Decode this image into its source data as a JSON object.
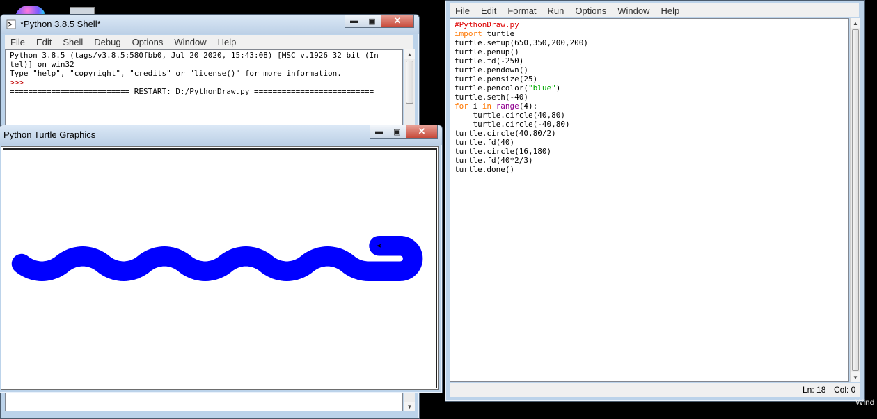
{
  "shell": {
    "title": "*Python 3.8.5 Shell*",
    "menu": [
      "File",
      "Edit",
      "Shell",
      "Debug",
      "Options",
      "Window",
      "Help"
    ],
    "lines": [
      "Python 3.8.5 (tags/v3.8.5:580fbb0, Jul 20 2020, 15:43:08) [MSC v.1926 32 bit (In",
      "tel)] on win32",
      "Type \"help\", \"copyright\", \"credits\" or \"license()\" for more information."
    ],
    "prompt": ">>>",
    "restart_line": "========================== RESTART: D:/PythonDraw.py =========================="
  },
  "turtle": {
    "title": "Python Turtle Graphics",
    "pen_color": "#0000ff",
    "pen_size": 25,
    "canvas_background": "#ffffff"
  },
  "editor": {
    "menu": [
      "File",
      "Edit",
      "Format",
      "Run",
      "Options",
      "Window",
      "Help"
    ],
    "code": [
      {
        "c": "#PythonDraw.py",
        "t": "cm"
      },
      {
        "k": "import",
        "r": " turtle"
      },
      "turtle.setup(650,350,200,200)",
      "turtle.penup()",
      "turtle.fd(-250)",
      "turtle.pendown()",
      "turtle.pensize(25)",
      {
        "pre": "turtle.pencolor(",
        "s": "\"blue\"",
        "post": ")"
      },
      "turtle.seth(-40)",
      {
        "for": true,
        "k": "for",
        "m": " i ",
        "k2": "in",
        "sp": " ",
        "b": "range",
        "r": "(4):"
      },
      "    turtle.circle(40,80)",
      "    turtle.circle(-40,80)",
      "turtle.circle(40,80/2)",
      "turtle.fd(40)",
      "turtle.circle(16,180)",
      "turtle.fd(40*2/3)",
      "turtle.done()"
    ],
    "status": {
      "line": "Ln: 18",
      "col": "Col: 0"
    }
  },
  "desktop": {
    "watermark_fragment": "Wind"
  }
}
